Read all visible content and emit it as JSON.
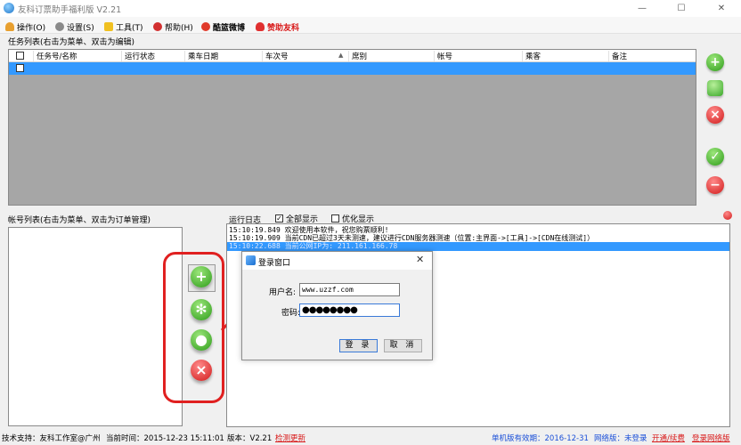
{
  "window": {
    "title": "友科订票助手福利版 V2.21",
    "minimize": "—",
    "maximize": "☐",
    "close": "✕"
  },
  "menu": {
    "operate": "操作(O)",
    "settings": "设置(S)",
    "tools": "工具(T)",
    "help": "帮助(H)",
    "weibo": "酷篮微博",
    "sponsor": "赞助友科"
  },
  "task_section": {
    "title": "任务列表(右击为菜单、双击为编辑)",
    "columns": [
      "任务号/名称",
      "运行状态",
      "乘车日期",
      "车次号",
      "席别",
      "帐号",
      "乘客",
      "备注"
    ]
  },
  "account_section": {
    "title": "帐号列表(右击为菜单、双击为订单管理)"
  },
  "log_section": {
    "title": "运行日志",
    "show_all_label": "全部显示",
    "show_all_checked": true,
    "optimize_label": "优化显示",
    "optimize_checked": false,
    "lines": [
      "15:10:19.849  欢迎使用本软件，祝您购票顺利!",
      "15:10:19.909  当前CDN已超过3天未测速，建议进行CDN服务器测速（位置:主界面->[工具]->[CDN在线测试]）",
      "15:10:22.688  当前公网IP为: 211.161.166.78"
    ]
  },
  "dialog": {
    "title": "登录窗口",
    "username_label": "用户名:",
    "username_value": "www.uzzf.com",
    "password_label": "密码:",
    "password_value": "●●●●●●●●",
    "login_button": "登 录",
    "cancel_button": "取 消"
  },
  "status": {
    "support": "技术支持：友科工作室@广州",
    "current_time": "当前时间：2015-12-23 15:11:01",
    "version": "版本：V2.21",
    "check_update": "检测更新",
    "standalone_valid": "单机版有效期：2016-12-31",
    "network_edition": "网络版：未登录",
    "open_renew": "开通/续费",
    "login_network": "登录网络版"
  },
  "colors": {
    "selection": "#3399ff",
    "annotation_red": "#e02020",
    "link_red": "#d81818",
    "link_blue": "#1a4fd8"
  },
  "icons": {
    "task_add": "plus-circle-icon",
    "task_copy": "copy-icon",
    "task_delete": "delete-icon",
    "task_start": "check-circle-icon",
    "task_stop": "minus-circle-icon",
    "log_clear": "stop-icon"
  }
}
